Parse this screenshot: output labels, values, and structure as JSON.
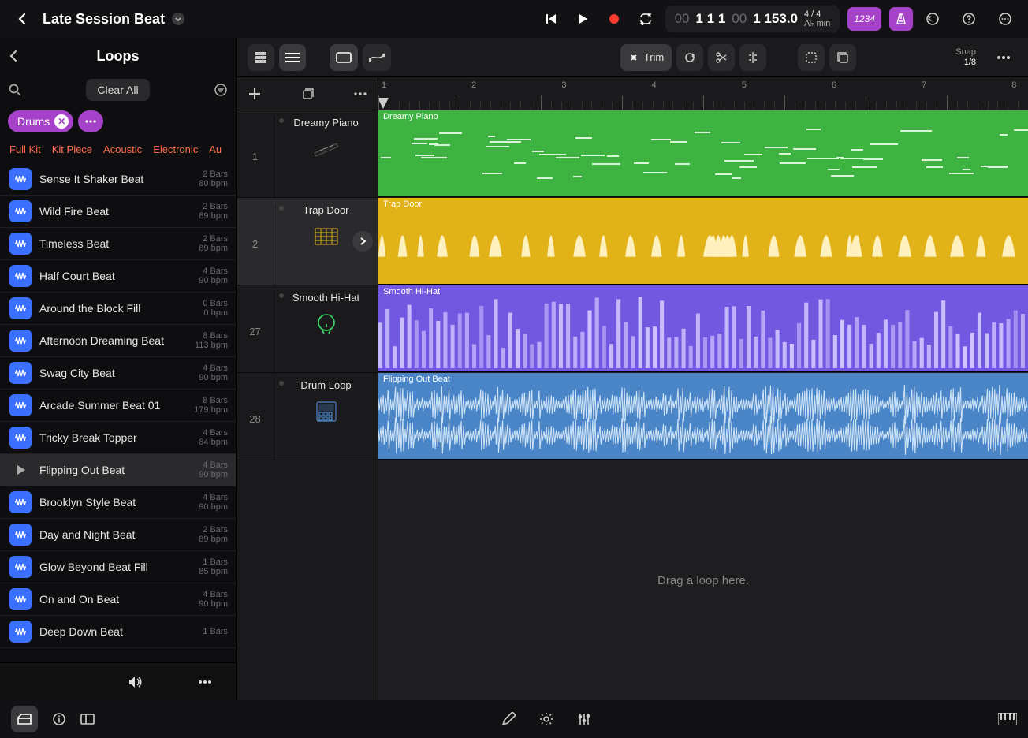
{
  "project": {
    "title": "Late Session Beat"
  },
  "transport": {
    "pos_prefix": "00",
    "position": "1 1 1",
    "loc_prefix": "00",
    "locator": "1  153.0",
    "signature": "4 / 4",
    "key": "A♭ min",
    "count_label": "1234"
  },
  "sidebar": {
    "title": "Loops",
    "clear": "Clear All",
    "tag": "Drums",
    "subfilters": [
      "Full Kit",
      "Kit Piece",
      "Acoustic",
      "Electronic",
      "Au"
    ]
  },
  "loops": [
    {
      "name": "Sense It Shaker Beat",
      "bars": "2 Bars",
      "bpm": "80 bpm",
      "playing": false
    },
    {
      "name": "Wild Fire Beat",
      "bars": "2 Bars",
      "bpm": "89 bpm",
      "playing": false
    },
    {
      "name": "Timeless Beat",
      "bars": "2 Bars",
      "bpm": "89 bpm",
      "playing": false
    },
    {
      "name": "Half Court Beat",
      "bars": "4 Bars",
      "bpm": "90 bpm",
      "playing": false
    },
    {
      "name": "Around the Block Fill",
      "bars": "0 Bars",
      "bpm": "0 bpm",
      "playing": false
    },
    {
      "name": "Afternoon Dreaming Beat",
      "bars": "8 Bars",
      "bpm": "113 bpm",
      "playing": false
    },
    {
      "name": "Swag City Beat",
      "bars": "4 Bars",
      "bpm": "90 bpm",
      "playing": false
    },
    {
      "name": "Arcade Summer Beat 01",
      "bars": "8 Bars",
      "bpm": "179 bpm",
      "playing": false
    },
    {
      "name": "Tricky Break Topper",
      "bars": "4 Bars",
      "bpm": "84 bpm",
      "playing": false
    },
    {
      "name": "Flipping Out Beat",
      "bars": "4 Bars",
      "bpm": "90 bpm",
      "playing": true
    },
    {
      "name": "Brooklyn Style Beat",
      "bars": "4 Bars",
      "bpm": "90 bpm",
      "playing": false
    },
    {
      "name": "Day and Night Beat",
      "bars": "2 Bars",
      "bpm": "89 bpm",
      "playing": false
    },
    {
      "name": "Glow Beyond Beat Fill",
      "bars": "1 Bars",
      "bpm": "85 bpm",
      "playing": false
    },
    {
      "name": "On and On Beat",
      "bars": "4 Bars",
      "bpm": "90 bpm",
      "playing": false
    },
    {
      "name": "Deep Down Beat",
      "bars": "1 Bars",
      "bpm": "",
      "playing": false
    }
  ],
  "toolbar": {
    "trim": "Trim",
    "snap_label": "Snap",
    "snap_value": "1/8"
  },
  "tracks": [
    {
      "num": "1",
      "name": "Dreamy Piano",
      "selected": false,
      "thumb": "piano"
    },
    {
      "num": "2",
      "name": "Trap Door",
      "selected": true,
      "thumb": "drumgrid"
    },
    {
      "num": "27",
      "name": "Smooth Hi-Hat",
      "selected": false,
      "thumb": "headphones"
    },
    {
      "num": "28",
      "name": "Drum Loop",
      "selected": false,
      "thumb": "sampler"
    }
  ],
  "regions": [
    {
      "name": "Dreamy Piano",
      "color": "green"
    },
    {
      "name": "Trap Door",
      "color": "yellow"
    },
    {
      "name": "Smooth Hi-Hat",
      "color": "purple"
    },
    {
      "name": "Flipping Out Beat",
      "color": "blue"
    }
  ],
  "ruler": {
    "bars": [
      "1",
      "2",
      "3",
      "4",
      "5",
      "6",
      "7",
      "8"
    ]
  },
  "drop_hint": "Drag a loop here."
}
